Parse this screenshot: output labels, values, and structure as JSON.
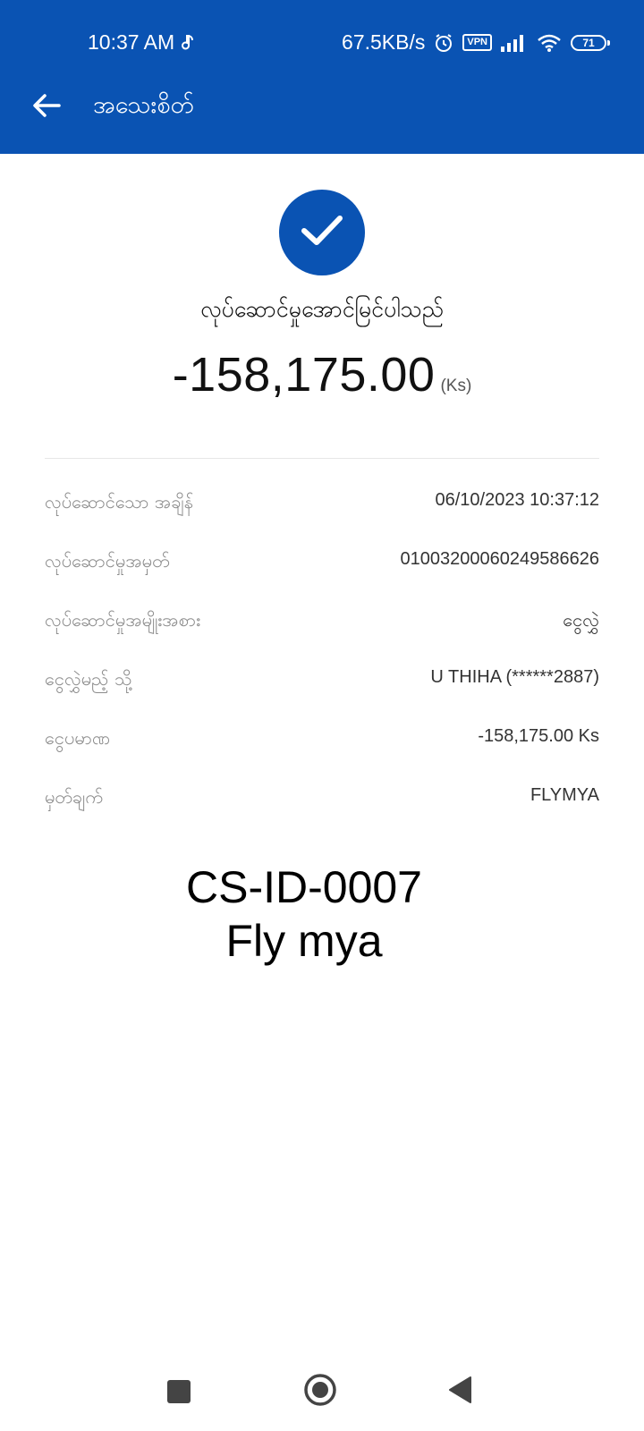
{
  "status_bar": {
    "time": "10:37 AM",
    "speed": "67.5KB/s",
    "vpn": "VPN",
    "battery": "71"
  },
  "app_bar": {
    "title": "အသေးစိတ်"
  },
  "receipt": {
    "status_text": "လုပ်ဆောင်မှုအောင်မြင်ပါသည်",
    "amount": "-158,175.00",
    "currency": "(Ks)",
    "rows": [
      {
        "label": "လုပ်ဆောင်သော အချိန်",
        "value": "06/10/2023 10:37:12"
      },
      {
        "label": "လုပ်ဆောင်မှုအမှတ်",
        "value": "01003200060249586626"
      },
      {
        "label": "လုပ်ဆောင်မှုအမျိုးအစား",
        "value": "ငွေလွှဲ"
      },
      {
        "label": "ငွေလွှဲမည့် သို့",
        "value": "U THIHA (******2887)"
      },
      {
        "label": "ငွေပမာဏ",
        "value": "-158,175.00 Ks"
      },
      {
        "label": "မှတ်ချက်",
        "value": "FLYMYA"
      }
    ]
  },
  "watermark": {
    "line1": "CS-ID-0007",
    "line2": "Fly mya"
  },
  "colors": {
    "brand": "#0a53b3"
  },
  "icons": {
    "back": "arrow-left-icon",
    "success": "checkmark-icon",
    "nav_recent": "square-icon",
    "nav_home": "circle-icon",
    "nav_back": "triangle-left-icon"
  }
}
